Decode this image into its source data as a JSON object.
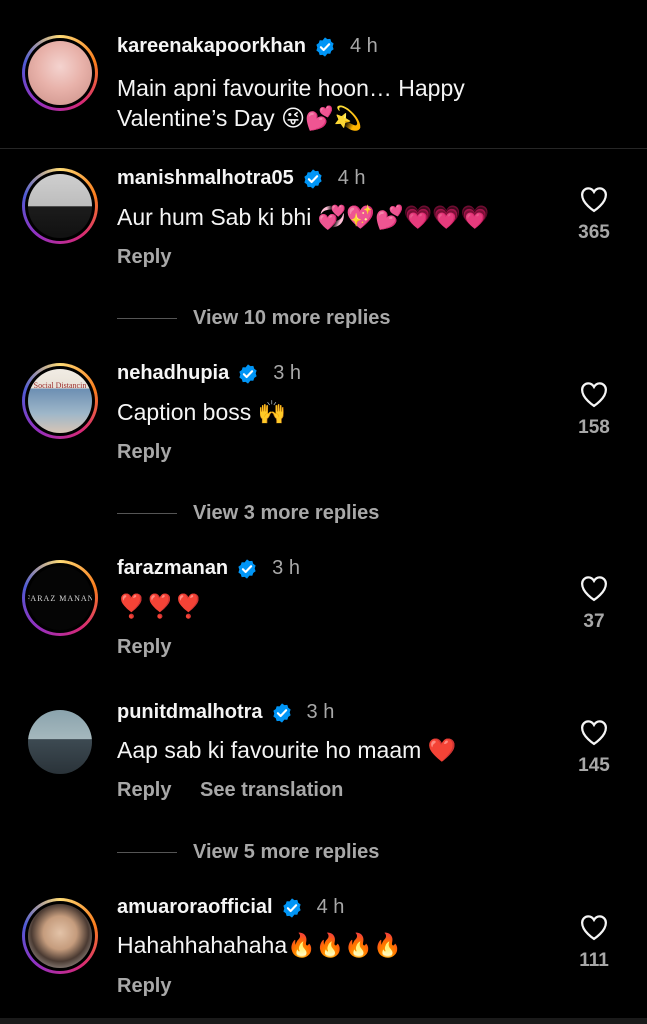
{
  "caption": {
    "username": "kareenakapoorkhan",
    "time": "4 h",
    "text_line1": "Main apni favourite hoon… Happy",
    "text_line2": "Valentine’s Day",
    "emojis": "😜💕💫"
  },
  "comments": [
    {
      "username": "manishmalhotra05",
      "time": "4 h",
      "text": "Aur hum Sab ki bhi",
      "emojis": "💞💖💕💗💗💗",
      "reply": "Reply",
      "likes": "365",
      "view_more": "View 10 more replies"
    },
    {
      "username": "nehadhupia",
      "time": "3 h",
      "text": "Caption boss",
      "emojis": "🙌",
      "reply": "Reply",
      "likes": "158",
      "view_more": "View 3 more replies",
      "avatar_caption": "Social Distancin"
    },
    {
      "username": "farazmanan",
      "time": "3 h",
      "text": "",
      "emojis": "❣️❣️❣️",
      "reply": "Reply",
      "likes": "37",
      "avatar_caption": "FARAZ MANAN"
    },
    {
      "username": "punitdmalhotra",
      "time": "3 h",
      "text": "Aap sab ki favourite ho maam",
      "emojis": "❤️",
      "reply": "Reply",
      "see_translation": "See translation",
      "likes": "145",
      "view_more": "View 5 more replies"
    },
    {
      "username": "amuaroraofficial",
      "time": "4 h",
      "text": "Hahahhahahaha",
      "emojis": "🔥🔥🔥🔥",
      "reply": "Reply",
      "likes": "111"
    }
  ],
  "colors": {
    "background": "#000000",
    "text": "#f5f5f5",
    "secondary": "#a8a8a8",
    "verified": "#0095f6"
  },
  "icons": {
    "verified": "verified-badge-icon",
    "like": "heart-outline-icon"
  }
}
